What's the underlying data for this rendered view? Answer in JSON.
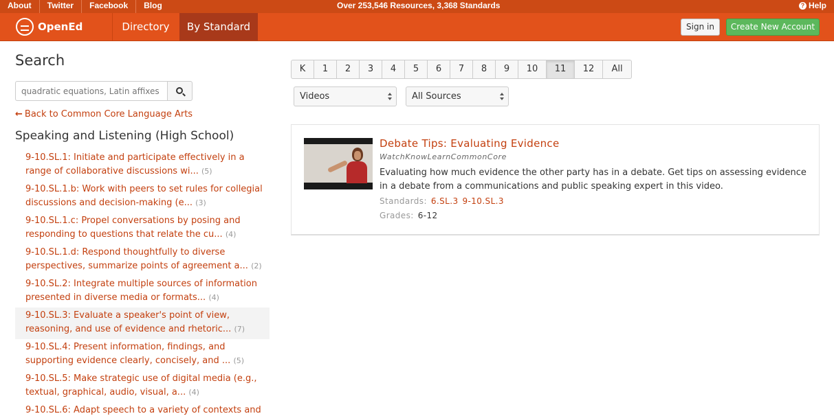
{
  "topbar": {
    "links": [
      "About",
      "Twitter",
      "Facebook",
      "Blog"
    ],
    "stats": "Over 253,546 Resources, 3,368 Standards",
    "help": "Help"
  },
  "nav": {
    "brand": "OpenEd",
    "directory": "Directory",
    "by_standard": "By Standard",
    "sign_in": "Sign in",
    "create_account": "Create New Account"
  },
  "sidebar": {
    "title": "Search",
    "search_placeholder": "quadratic equations, Latin affixes",
    "back_link": "Back to Common Core Language Arts",
    "section_title": "Speaking and Listening (High School)",
    "standards": [
      {
        "text": "9-10.SL.1: Initiate and participate effectively in a range of collaborative discussions wi...",
        "count": "(5)"
      },
      {
        "text": "9-10.SL.1.b: Work with peers to set rules for collegial discussions and decision-making (e...",
        "count": "(3)"
      },
      {
        "text": "9-10.SL.1.c: Propel conversations by posing and responding to questions that relate the cu...",
        "count": "(4)"
      },
      {
        "text": "9-10.SL.1.d: Respond thoughtfully to diverse perspectives, summarize points of agreement a...",
        "count": "(2)"
      },
      {
        "text": "9-10.SL.2: Integrate multiple sources of information presented in diverse media or formats...",
        "count": "(4)"
      },
      {
        "text": "9-10.SL.3: Evaluate a speaker's point of view, reasoning, and use of evidence and rhetoric...",
        "count": "(7)"
      },
      {
        "text": "9-10.SL.4: Present information, findings, and supporting evidence clearly, concisely, and ...",
        "count": "(5)"
      },
      {
        "text": "9-10.SL.5: Make strategic use of digital media (e.g., textual, graphical, audio, visual, a...",
        "count": "(4)"
      },
      {
        "text": "9-10.SL.6: Adapt speech to a variety of contexts and",
        "count": ""
      }
    ]
  },
  "grades": [
    "K",
    "1",
    "2",
    "3",
    "4",
    "5",
    "6",
    "7",
    "8",
    "9",
    "10",
    "11",
    "12",
    "All"
  ],
  "filters": {
    "type": "Videos",
    "source": "All Sources"
  },
  "result": {
    "title": "Debate Tips: Evaluating Evidence",
    "source": "WatchKnowLearnCommonCore",
    "description": "Evaluating how much evidence the other party has in a debate. Get tips on assessing evidence in a debate from a communications and public speaking expert in this video.",
    "standards_label": "Standards:",
    "standards": [
      "6.SL.3",
      "9-10.SL.3"
    ],
    "grades_label": "Grades:",
    "grades": "6-12"
  }
}
